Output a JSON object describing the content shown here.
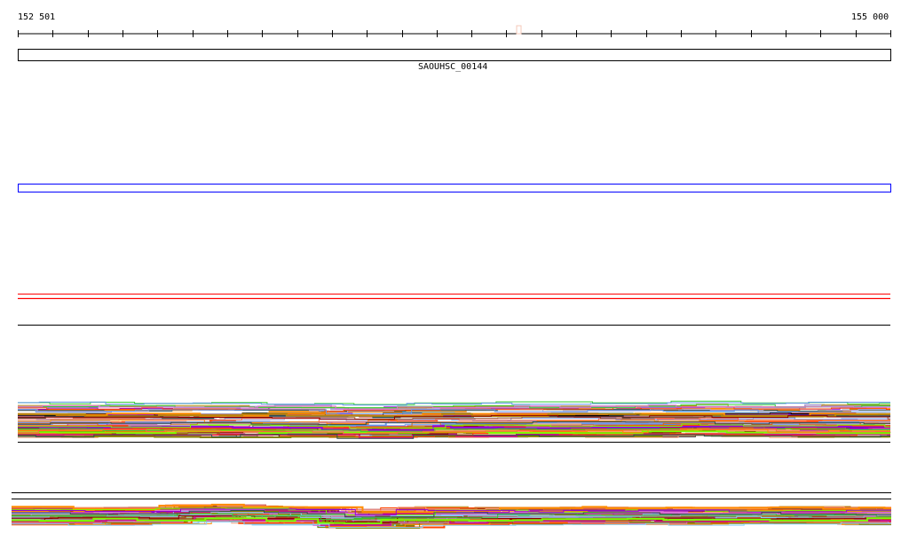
{
  "ruler": {
    "start_label": "152 501",
    "end_label": "155 000",
    "tick_count": 26
  },
  "gene_track": {
    "gene_label": "SAOUHSC_00144"
  },
  "colors": {
    "ruler": "#000000",
    "gene_box": "#000000",
    "blue_track": "#0000ff",
    "red_track": "#ff0000",
    "coverage_palette": [
      "#000000",
      "#c71585",
      "#ff6347",
      "#ffa07a",
      "#b0a0d0",
      "#ff8c00",
      "#808000",
      "#8b0000",
      "#7cfc00",
      "#6495ed",
      "#87cefa",
      "#d2691e",
      "#b8860b",
      "#ff4500",
      "#9400d3",
      "#2f4f4f",
      "#da70d6",
      "#a0522d",
      "#cd5c5c",
      "#32cd32"
    ]
  }
}
